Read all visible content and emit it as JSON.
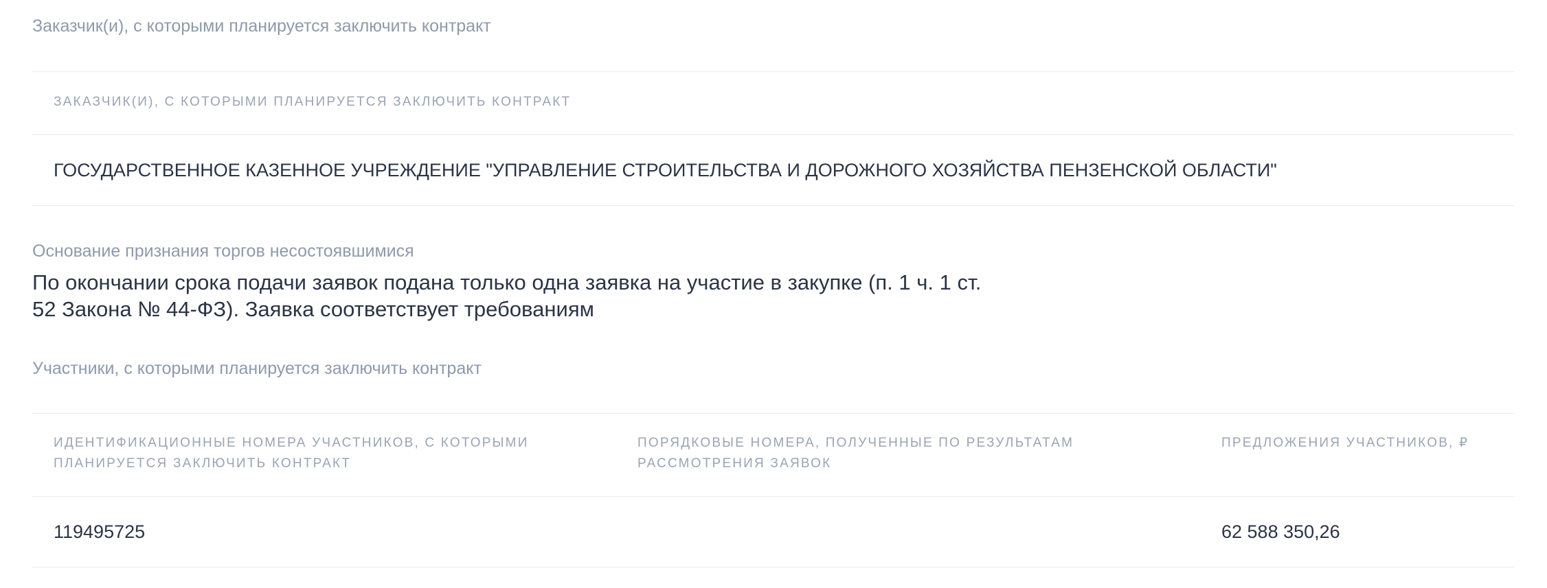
{
  "customers_section": {
    "label": "Заказчик(и), с которыми планируется заключить контракт",
    "table": {
      "header": "ЗАКАЗЧИК(И), С КОТОРЫМИ ПЛАНИРУЕТСЯ ЗАКЛЮЧИТЬ КОНТРАКТ",
      "rows": [
        "ГОСУДАРСТВЕННОЕ КАЗЕННОЕ УЧРЕЖДЕНИЕ \"УПРАВЛЕНИЕ СТРОИТЕЛЬСТВА И ДОРОЖНОГО ХОЗЯЙСТВА ПЕНЗЕНСКОЙ ОБЛАСТИ\""
      ]
    }
  },
  "failure_reason": {
    "label": "Основание признания торгов несостоявшимися",
    "text_line1": "По окончании срока подачи заявок подана только одна заявка на участие в закупке (п. 1 ч. 1 ст.",
    "text_line2": "52 Закона № 44-ФЗ). Заявка соответствует требованиям"
  },
  "participants_section": {
    "label": "Участники, с которыми планируется заключить контракт",
    "table": {
      "headers": [
        "ИДЕНТИФИКАЦИОННЫЕ НОМЕРА УЧАСТНИКОВ, С КОТОРЫМИ ПЛАНИРУЕТСЯ ЗАКЛЮЧИТЬ КОНТРАКТ",
        "ПОРЯДКОВЫЕ НОМЕРА, ПОЛУЧЕННЫЕ ПО РЕЗУЛЬТАТАМ РАССМОТРЕНИЯ ЗАЯВОК",
        "ПРЕДЛОЖЕНИЯ УЧАСТНИКОВ, ₽"
      ],
      "rows": [
        {
          "id": "119495725",
          "order_number": "",
          "offer": "62 588 350,26"
        }
      ]
    }
  }
}
